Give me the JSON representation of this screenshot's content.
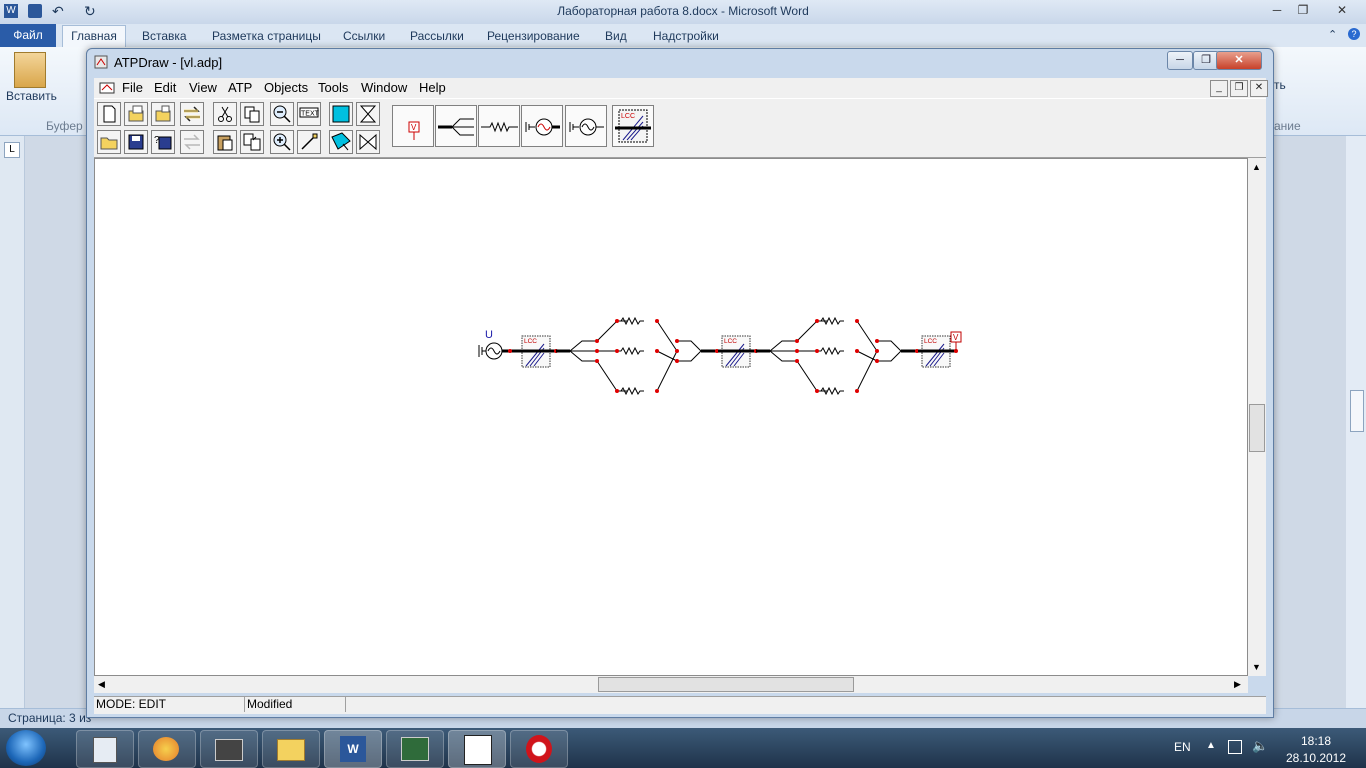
{
  "word": {
    "title": "Лабораторная работа 8.docx - Microsoft Word",
    "tabs": [
      "Главная",
      "Вставка",
      "Разметка страницы",
      "Ссылки",
      "Рассылки",
      "Рецензирование",
      "Вид",
      "Надстройки"
    ],
    "file_tab": "Файл",
    "paste_label": "Вставить",
    "clipboard_group": "Буфер о",
    "right_group_frag": "ть",
    "right_group_frag2": "ание",
    "status_text": "Страница: 3 из"
  },
  "atp": {
    "title": "ATPDraw - [vl.adp]",
    "menu": [
      "File",
      "Edit",
      "View",
      "ATP",
      "Objects",
      "Tools",
      "Window",
      "Help"
    ],
    "source_label": "U",
    "lcc_label": "LCC",
    "status_mode": "MODE: EDIT",
    "status_modified": "Modified"
  },
  "taskbar": {
    "lang": "EN",
    "time": "18:18",
    "date": "28.10.2012"
  },
  "colors": {
    "node": "#e00000",
    "lcc_text": "#c00000",
    "source_label": "#1a1aa8",
    "probe": "#c00000"
  }
}
